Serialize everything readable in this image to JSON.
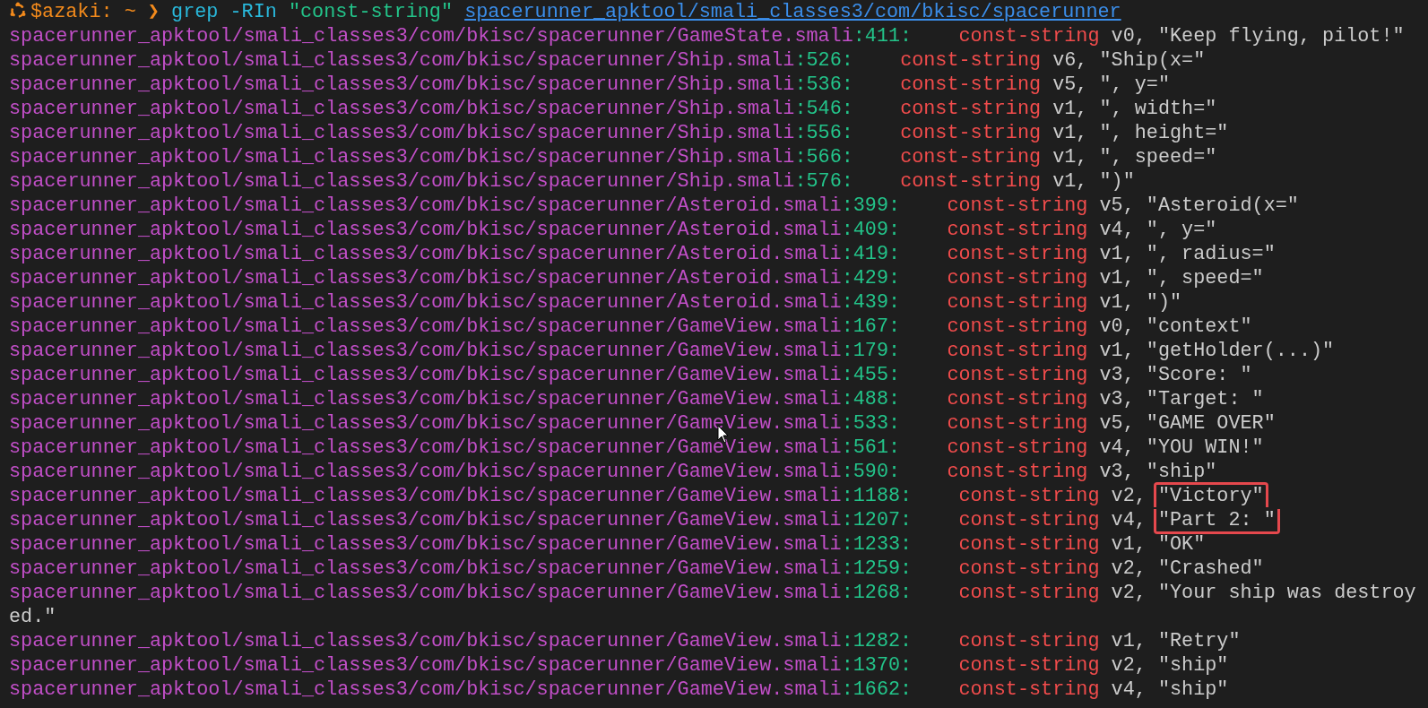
{
  "prompt": {
    "user": "$azaki:",
    "directory": "~",
    "symbol": "❯",
    "command": "grep",
    "flags": "-RIn",
    "pattern": "\"const-string\"",
    "argument": "spacerunner_apktool/smali_classes3/com/bkisc/spacerunner"
  },
  "results": [
    {
      "path": "spacerunner_apktool/smali_classes3/com/bkisc/spacerunner/GameState.smali",
      "line": ":411:",
      "instruction": "const-string",
      "operands": "v0,",
      "value": "\"Keep flying, pilot!\"",
      "highlighted": false
    },
    {
      "path": "spacerunner_apktool/smali_classes3/com/bkisc/spacerunner/Ship.smali",
      "line": ":526:",
      "instruction": "const-string",
      "operands": "v6,",
      "value": "\"Ship(x=\"",
      "highlighted": false
    },
    {
      "path": "spacerunner_apktool/smali_classes3/com/bkisc/spacerunner/Ship.smali",
      "line": ":536:",
      "instruction": "const-string",
      "operands": "v5,",
      "value": "\", y=\"",
      "highlighted": false
    },
    {
      "path": "spacerunner_apktool/smali_classes3/com/bkisc/spacerunner/Ship.smali",
      "line": ":546:",
      "instruction": "const-string",
      "operands": "v1,",
      "value": "\", width=\"",
      "highlighted": false
    },
    {
      "path": "spacerunner_apktool/smali_classes3/com/bkisc/spacerunner/Ship.smali",
      "line": ":556:",
      "instruction": "const-string",
      "operands": "v1,",
      "value": "\", height=\"",
      "highlighted": false
    },
    {
      "path": "spacerunner_apktool/smali_classes3/com/bkisc/spacerunner/Ship.smali",
      "line": ":566:",
      "instruction": "const-string",
      "operands": "v1,",
      "value": "\", speed=\"",
      "highlighted": false
    },
    {
      "path": "spacerunner_apktool/smali_classes3/com/bkisc/spacerunner/Ship.smali",
      "line": ":576:",
      "instruction": "const-string",
      "operands": "v1,",
      "value": "\")\"",
      "highlighted": false
    },
    {
      "path": "spacerunner_apktool/smali_classes3/com/bkisc/spacerunner/Asteroid.smali",
      "line": ":399:",
      "instruction": "const-string",
      "operands": "v5,",
      "value": "\"Asteroid(x=\"",
      "highlighted": false
    },
    {
      "path": "spacerunner_apktool/smali_classes3/com/bkisc/spacerunner/Asteroid.smali",
      "line": ":409:",
      "instruction": "const-string",
      "operands": "v4,",
      "value": "\", y=\"",
      "highlighted": false
    },
    {
      "path": "spacerunner_apktool/smali_classes3/com/bkisc/spacerunner/Asteroid.smali",
      "line": ":419:",
      "instruction": "const-string",
      "operands": "v1,",
      "value": "\", radius=\"",
      "highlighted": false
    },
    {
      "path": "spacerunner_apktool/smali_classes3/com/bkisc/spacerunner/Asteroid.smali",
      "line": ":429:",
      "instruction": "const-string",
      "operands": "v1,",
      "value": "\", speed=\"",
      "highlighted": false
    },
    {
      "path": "spacerunner_apktool/smali_classes3/com/bkisc/spacerunner/Asteroid.smali",
      "line": ":439:",
      "instruction": "const-string",
      "operands": "v1,",
      "value": "\")\"",
      "highlighted": false
    },
    {
      "path": "spacerunner_apktool/smali_classes3/com/bkisc/spacerunner/GameView.smali",
      "line": ":167:",
      "instruction": "const-string",
      "operands": "v0,",
      "value": "\"context\"",
      "highlighted": false
    },
    {
      "path": "spacerunner_apktool/smali_classes3/com/bkisc/spacerunner/GameView.smali",
      "line": ":179:",
      "instruction": "const-string",
      "operands": "v1,",
      "value": "\"getHolder(...)\"",
      "highlighted": false
    },
    {
      "path": "spacerunner_apktool/smali_classes3/com/bkisc/spacerunner/GameView.smali",
      "line": ":455:",
      "instruction": "const-string",
      "operands": "v3,",
      "value": "\"Score: \"",
      "highlighted": false
    },
    {
      "path": "spacerunner_apktool/smali_classes3/com/bkisc/spacerunner/GameView.smali",
      "line": ":488:",
      "instruction": "const-string",
      "operands": "v3,",
      "value": "\"Target: \"",
      "highlighted": false
    },
    {
      "path": "spacerunner_apktool/smali_classes3/com/bkisc/spacerunner/GameView.smali",
      "line": ":533:",
      "instruction": "const-string",
      "operands": "v5,",
      "value": "\"GAME OVER\"",
      "highlighted": false
    },
    {
      "path": "spacerunner_apktool/smali_classes3/com/bkisc/spacerunner/GameView.smali",
      "line": ":561:",
      "instruction": "const-string",
      "operands": "v4,",
      "value": "\"YOU WIN!\"",
      "highlighted": false
    },
    {
      "path": "spacerunner_apktool/smali_classes3/com/bkisc/spacerunner/GameView.smali",
      "line": ":590:",
      "instruction": "const-string",
      "operands": "v3,",
      "value": "\"ship\"",
      "highlighted": false
    },
    {
      "path": "spacerunner_apktool/smali_classes3/com/bkisc/spacerunner/GameView.smali",
      "line": ":1188:",
      "instruction": "const-string",
      "operands": "v2,",
      "value": "\"Victory\"",
      "highlighted": true
    },
    {
      "path": "spacerunner_apktool/smali_classes3/com/bkisc/spacerunner/GameView.smali",
      "line": ":1207:",
      "instruction": "const-string",
      "operands": "v4,",
      "value": "\"Part 2: \"",
      "highlighted": true
    },
    {
      "path": "spacerunner_apktool/smali_classes3/com/bkisc/spacerunner/GameView.smali",
      "line": ":1233:",
      "instruction": "const-string",
      "operands": "v1,",
      "value": "\"OK\"",
      "highlighted": false
    },
    {
      "path": "spacerunner_apktool/smali_classes3/com/bkisc/spacerunner/GameView.smali",
      "line": ":1259:",
      "instruction": "const-string",
      "operands": "v2,",
      "value": "\"Crashed\"",
      "highlighted": false
    },
    {
      "path": "spacerunner_apktool/smali_classes3/com/bkisc/spacerunner/GameView.smali",
      "line": ":1268:",
      "instruction": "const-string",
      "operands": "v2,",
      "value": "\"Your ship was destroy",
      "continuation": "ed.\"",
      "highlighted": false
    },
    {
      "path": "spacerunner_apktool/smali_classes3/com/bkisc/spacerunner/GameView.smali",
      "line": ":1282:",
      "instruction": "const-string",
      "operands": "v1,",
      "value": "\"Retry\"",
      "highlighted": false
    },
    {
      "path": "spacerunner_apktool/smali_classes3/com/bkisc/spacerunner/GameView.smali",
      "line": ":1370:",
      "instruction": "const-string",
      "operands": "v2,",
      "value": "\"ship\"",
      "highlighted": false
    },
    {
      "path": "spacerunner_apktool/smali_classes3/com/bkisc/spacerunner/GameView.smali",
      "line": ":1662:",
      "instruction": "const-string",
      "operands": "v4,",
      "value": "\"ship\"",
      "highlighted": false
    }
  ]
}
